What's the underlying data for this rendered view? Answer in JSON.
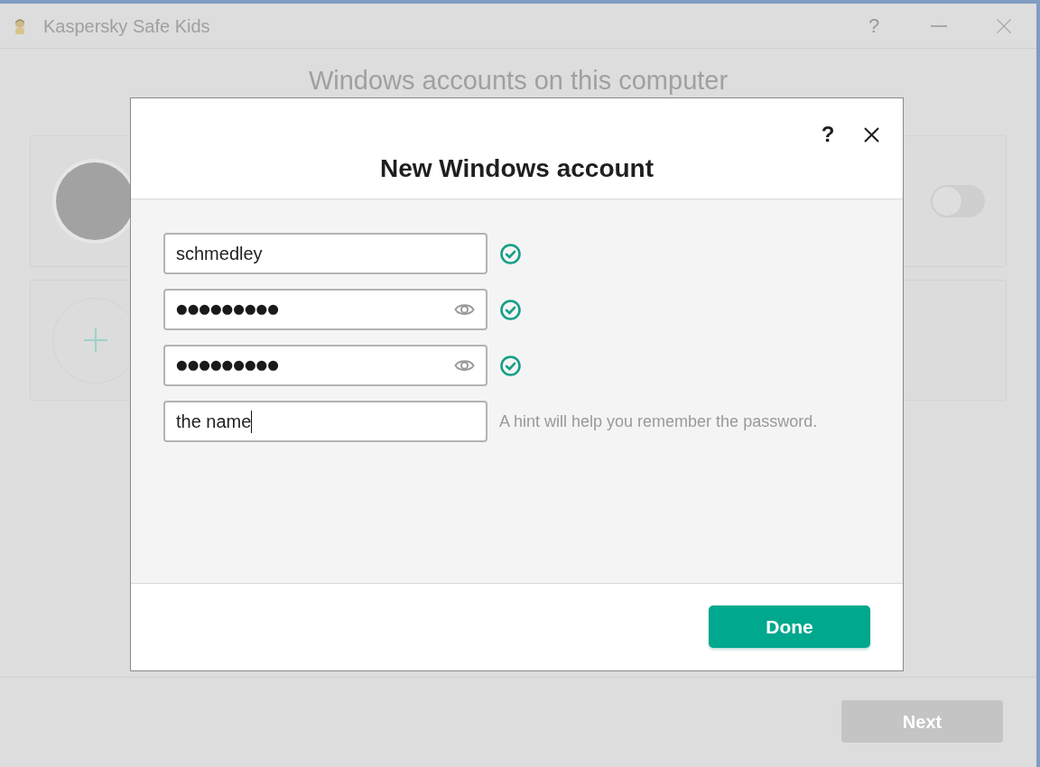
{
  "window": {
    "title": "Kaspersky Safe Kids",
    "help": "?"
  },
  "page": {
    "heading": "Windows accounts on this computer",
    "accounts": [
      {
        "kind": "account",
        "on": false
      },
      {
        "kind": "add"
      }
    ],
    "next_button": {
      "label": "Next",
      "disabled": true
    }
  },
  "dialog": {
    "title": "New Windows account",
    "help": "?",
    "fields": [
      {
        "kind": "text",
        "value": "schmedley",
        "valid": true,
        "focused": false
      },
      {
        "kind": "password",
        "value": "●●●●●●●●●",
        "valid": true,
        "focused": false
      },
      {
        "kind": "password",
        "value": "●●●●●●●●●",
        "valid": true,
        "focused": false
      },
      {
        "kind": "text",
        "value": "the name",
        "valid": false,
        "focused": true,
        "note": "A hint will help you remember the password."
      }
    ],
    "done_button": "Done"
  }
}
